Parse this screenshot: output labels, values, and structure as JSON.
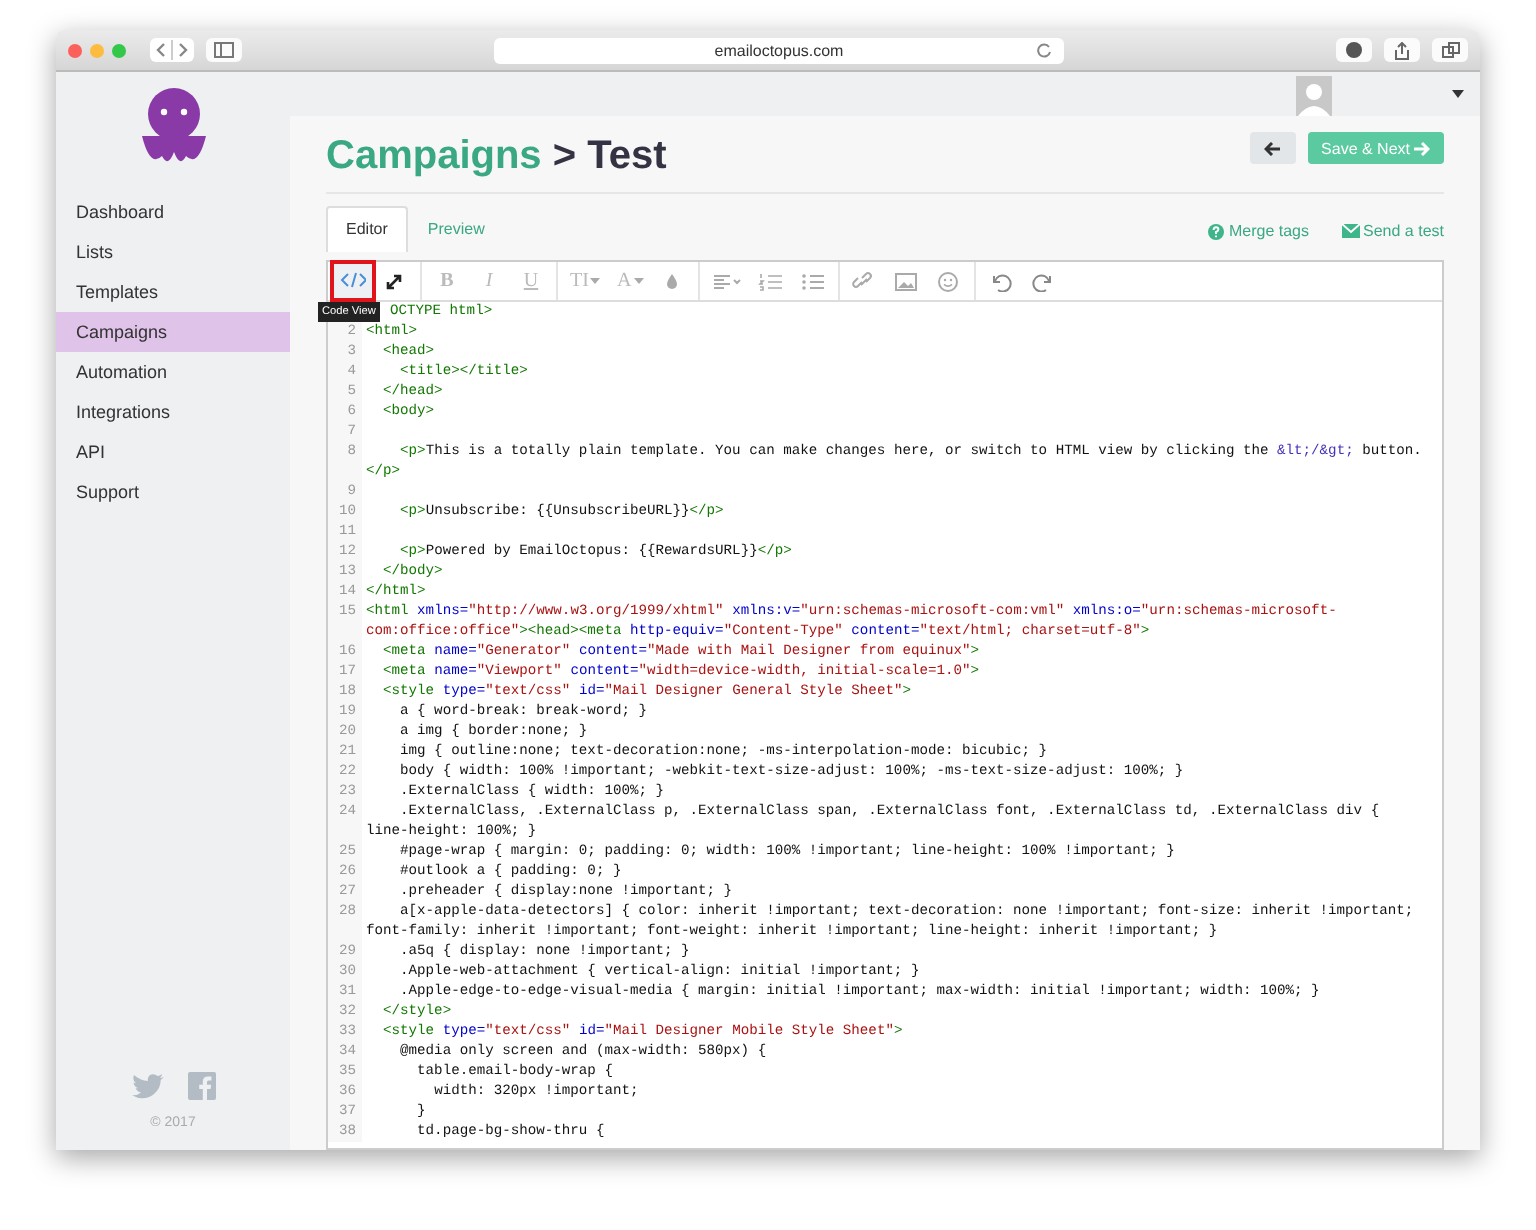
{
  "browser": {
    "url": "emailoctopus.com"
  },
  "sidebar": {
    "items": [
      {
        "label": "Dashboard",
        "selected": false
      },
      {
        "label": "Lists",
        "selected": false
      },
      {
        "label": "Templates",
        "selected": false
      },
      {
        "label": "Campaigns",
        "selected": true
      },
      {
        "label": "Automation",
        "selected": false
      },
      {
        "label": "Integrations",
        "selected": false
      },
      {
        "label": "API",
        "selected": false
      },
      {
        "label": "Support",
        "selected": false
      }
    ],
    "copyright": "© 2017"
  },
  "header": {
    "breadcrumb": "Campaigns",
    "separator": ">",
    "title": "Test",
    "save_button": "Save & Next"
  },
  "tabs": [
    {
      "label": "Editor",
      "selected": true
    },
    {
      "label": "Preview",
      "selected": false
    }
  ],
  "links": [
    "Merge tags",
    "Send a test"
  ],
  "toolbar": [
    [
      {
        "kind": "code",
        "highlighted": true,
        "tooltip": "Code View"
      },
      {
        "kind": "expand",
        "highlighted": false
      }
    ],
    [
      {
        "kind": "bold",
        "label": "B",
        "highlighted": false
      },
      {
        "kind": "italic",
        "label": "I",
        "highlighted": false
      },
      {
        "kind": "underline",
        "label": "U",
        "highlighted": false
      }
    ],
    [
      {
        "kind": "size",
        "label": "TI",
        "highlighted": false
      },
      {
        "kind": "font",
        "label": "A",
        "highlighted": false
      },
      {
        "kind": "color",
        "highlighted": false
      }
    ],
    [
      {
        "kind": "align",
        "highlighted": false
      },
      {
        "kind": "ol",
        "highlighted": false
      },
      {
        "kind": "ul",
        "highlighted": false
      }
    ],
    [
      {
        "kind": "link",
        "highlighted": false
      },
      {
        "kind": "image",
        "highlighted": false
      },
      {
        "kind": "emoji",
        "highlighted": false
      }
    ],
    [
      {
        "kind": "undo",
        "highlighted": false
      },
      {
        "kind": "redo",
        "highlighted": false
      }
    ]
  ],
  "code": [
    {
      "tokens": [
        {
          "kind": "tag",
          "text": "OCTYPE html>"
        }
      ]
    },
    {
      "number": "2",
      "tokens": [
        {
          "kind": "tag",
          "text": "<html>"
        }
      ]
    },
    {
      "number": "3",
      "tokens": [
        {
          "kind": "tag",
          "text": "  <head>"
        }
      ]
    },
    {
      "number": "4",
      "tokens": [
        {
          "kind": "tag",
          "text": "    <title></title>"
        }
      ]
    },
    {
      "number": "5",
      "tokens": [
        {
          "kind": "tag",
          "text": "  </head>"
        }
      ]
    },
    {
      "number": "6",
      "tokens": [
        {
          "kind": "tag",
          "text": "  <body>"
        }
      ]
    },
    {
      "number": "7"
    },
    {
      "number": "8",
      "tokens": [
        {
          "kind": "tag",
          "text": "    <p>"
        },
        {
          "kind": "text",
          "text": "This is a totally plain template. You can make changes here, or switch to HTML view by clicking the "
        },
        {
          "kind": "entity",
          "text": "&lt;/&gt;"
        },
        {
          "kind": "text",
          "text": " button."
        },
        {
          "kind": "tag",
          "text": "</p>"
        }
      ]
    },
    {
      "number": "9"
    },
    {
      "number": "10",
      "tokens": [
        {
          "kind": "tag",
          "text": "    <p>"
        },
        {
          "kind": "text",
          "text": "Unsubscribe: {{UnsubscribeURL}}"
        },
        {
          "kind": "tag",
          "text": "</p>"
        }
      ]
    },
    {
      "number": "11"
    },
    {
      "number": "12",
      "tokens": [
        {
          "kind": "tag",
          "text": "    <p>"
        },
        {
          "kind": "text",
          "text": "Powered by EmailOctopus: {{RewardsURL}}"
        },
        {
          "kind": "tag",
          "text": "</p>"
        }
      ]
    },
    {
      "number": "13",
      "tokens": [
        {
          "kind": "tag",
          "text": "  </body>"
        }
      ]
    },
    {
      "number": "14",
      "tokens": [
        {
          "kind": "tag",
          "text": "</html>"
        }
      ]
    },
    {
      "number": "15",
      "tokens": [
        {
          "kind": "tag",
          "text": "<html"
        },
        {
          "kind": "attr",
          "text": " xmlns="
        },
        {
          "kind": "string",
          "text": "\"http://www.w3.org/1999/xhtml\""
        },
        {
          "kind": "attr",
          "text": " xmlns:v="
        },
        {
          "kind": "string",
          "text": "\"urn:schemas-microsoft-com:vml\""
        },
        {
          "kind": "attr",
          "text": " xmlns:o="
        },
        {
          "kind": "string",
          "text": "\"urn:schemas-microsoft-com:office:office\""
        },
        {
          "kind": "tag",
          "text": "><head><meta"
        },
        {
          "kind": "attr",
          "text": " http-equiv="
        },
        {
          "kind": "string",
          "text": "\"Content-Type\""
        },
        {
          "kind": "attr",
          "text": " content="
        },
        {
          "kind": "string",
          "text": "\"text/html; charset=utf-8\""
        },
        {
          "kind": "tag",
          "text": ">"
        }
      ]
    },
    {
      "number": "16",
      "tokens": [
        {
          "kind": "tag",
          "text": "  <meta"
        },
        {
          "kind": "attr",
          "text": " name="
        },
        {
          "kind": "string",
          "text": "\"Generator\""
        },
        {
          "kind": "attr",
          "text": " content="
        },
        {
          "kind": "string",
          "text": "\"Made with Mail Designer from equinux\""
        },
        {
          "kind": "tag",
          "text": ">"
        }
      ]
    },
    {
      "number": "17",
      "tokens": [
        {
          "kind": "tag",
          "text": "  <meta"
        },
        {
          "kind": "attr",
          "text": " name="
        },
        {
          "kind": "string",
          "text": "\"Viewport\""
        },
        {
          "kind": "attr",
          "text": " content="
        },
        {
          "kind": "string",
          "text": "\"width=device-width, initial-scale=1.0\""
        },
        {
          "kind": "tag",
          "text": ">"
        }
      ]
    },
    {
      "number": "18",
      "tokens": [
        {
          "kind": "tag",
          "text": "  <style"
        },
        {
          "kind": "attr",
          "text": " type="
        },
        {
          "kind": "string",
          "text": "\"text/css\""
        },
        {
          "kind": "attr",
          "text": " id="
        },
        {
          "kind": "string",
          "text": "\"Mail Designer General Style Sheet\""
        },
        {
          "kind": "tag",
          "text": ">"
        }
      ]
    },
    {
      "number": "19",
      "tokens": [
        {
          "kind": "text",
          "text": "    a { word-break: break-word; }"
        }
      ]
    },
    {
      "number": "20",
      "tokens": [
        {
          "kind": "text",
          "text": "    a img { border:none; }"
        }
      ]
    },
    {
      "number": "21",
      "tokens": [
        {
          "kind": "text",
          "text": "    img { outline:none; text-decoration:none; -ms-interpolation-mode: bicubic; }"
        }
      ]
    },
    {
      "number": "22",
      "tokens": [
        {
          "kind": "text",
          "text": "    body { width: 100% !important; -webkit-text-size-adjust: 100%; -ms-text-size-adjust: 100%; }"
        }
      ]
    },
    {
      "number": "23",
      "tokens": [
        {
          "kind": "text",
          "text": "    .ExternalClass { width: 100%; }"
        }
      ]
    },
    {
      "number": "24",
      "tokens": [
        {
          "kind": "text",
          "text": "    .ExternalClass, .ExternalClass p, .ExternalClass span, .ExternalClass font, .ExternalClass td, .ExternalClass div { line-height: 100%; }"
        }
      ]
    },
    {
      "number": "25",
      "tokens": [
        {
          "kind": "text",
          "text": "    #page-wrap { margin: 0; padding: 0; width: 100% !important; line-height: 100% !important; }"
        }
      ]
    },
    {
      "number": "26",
      "tokens": [
        {
          "kind": "text",
          "text": "    #outlook a { padding: 0; }"
        }
      ]
    },
    {
      "number": "27",
      "tokens": [
        {
          "kind": "text",
          "text": "    .preheader { display:none !important; }"
        }
      ]
    },
    {
      "number": "28",
      "tokens": [
        {
          "kind": "text",
          "text": "    a[x-apple-data-detectors] { color: inherit !important; text-decoration: none !important; font-size: inherit !important; font-family: inherit !important; font-weight: inherit !important; line-height: inherit !important; }"
        }
      ]
    },
    {
      "number": "29",
      "tokens": [
        {
          "kind": "text",
          "text": "    .a5q { display: none !important; }"
        }
      ]
    },
    {
      "number": "30",
      "tokens": [
        {
          "kind": "text",
          "text": "    .Apple-web-attachment { vertical-align: initial !important; }"
        }
      ]
    },
    {
      "number": "31",
      "tokens": [
        {
          "kind": "text",
          "text": "    .Apple-edge-to-edge-visual-media { margin: initial !important; max-width: initial !important; width: 100%; }"
        }
      ]
    },
    {
      "number": "32",
      "tokens": [
        {
          "kind": "tag",
          "text": "  </style>"
        }
      ]
    },
    {
      "number": "33",
      "tokens": [
        {
          "kind": "tag",
          "text": "  <style"
        },
        {
          "kind": "attr",
          "text": " type="
        },
        {
          "kind": "string",
          "text": "\"text/css\""
        },
        {
          "kind": "attr",
          "text": " id="
        },
        {
          "kind": "string",
          "text": "\"Mail Designer Mobile Style Sheet\""
        },
        {
          "kind": "tag",
          "text": ">"
        }
      ]
    },
    {
      "number": "34",
      "tokens": [
        {
          "kind": "text",
          "text": "    @media only screen and (max-width: 580px) {"
        }
      ]
    },
    {
      "number": "35",
      "tokens": [
        {
          "kind": "text",
          "text": "      table.email-body-wrap {"
        }
      ]
    },
    {
      "number": "36",
      "tokens": [
        {
          "kind": "text",
          "text": "        width: 320px !important;"
        }
      ]
    },
    {
      "number": "37",
      "tokens": [
        {
          "kind": "text",
          "text": "      }"
        }
      ]
    },
    {
      "number": "38",
      "tokens": [
        {
          "kind": "text",
          "text": "      td.page-bg-show-thru {"
        }
      ]
    }
  ]
}
